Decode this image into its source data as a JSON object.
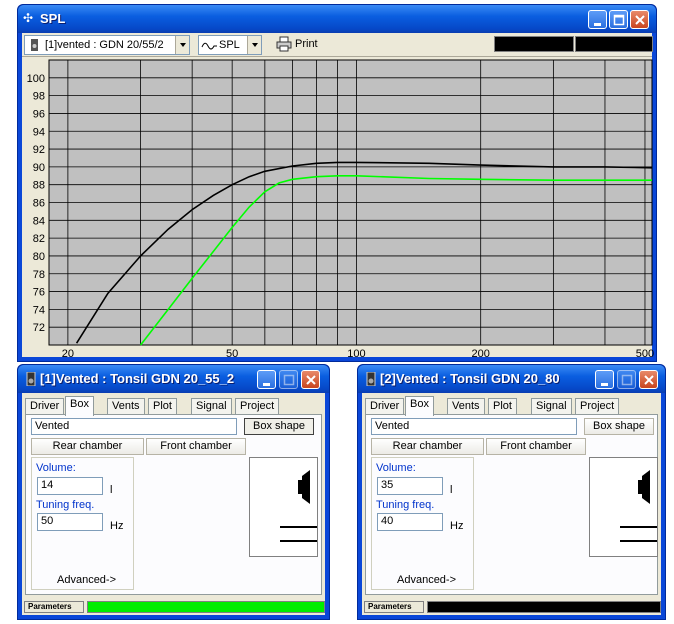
{
  "spl_window": {
    "title": "SPL",
    "toolbar": {
      "project_select": "[1]vented : GDN 20/55/2",
      "curve_select": "SPL",
      "print_label": "Print"
    }
  },
  "chart_data": {
    "type": "line",
    "xscale": "log",
    "xlim": [
      18,
      520
    ],
    "ylim": [
      70,
      102
    ],
    "x_ticks": [
      20,
      50,
      100,
      200,
      500
    ],
    "y_ticks": [
      72,
      74,
      76,
      78,
      80,
      82,
      84,
      86,
      88,
      90,
      92,
      94,
      96,
      98,
      100
    ],
    "grid": true,
    "series": [
      {
        "color": "#000000",
        "x": [
          21,
          25,
          30,
          35,
          40,
          45,
          50,
          55,
          60,
          70,
          80,
          90,
          100,
          150,
          200,
          300,
          400,
          520
        ],
        "y": [
          70.2,
          75.8,
          80.0,
          83.0,
          85.2,
          86.8,
          88.0,
          88.9,
          89.5,
          90.1,
          90.4,
          90.5,
          90.5,
          90.4,
          90.2,
          90.0,
          90.0,
          89.9
        ]
      },
      {
        "color": "#00ff00",
        "x": [
          30,
          35,
          40,
          45,
          50,
          55,
          60,
          65,
          70,
          80,
          90,
          100,
          150,
          200,
          300,
          400,
          520
        ],
        "y": [
          70.0,
          74.0,
          77.5,
          80.5,
          83.2,
          85.5,
          87.2,
          88.2,
          88.6,
          88.9,
          89.0,
          89.0,
          88.7,
          88.6,
          88.5,
          88.5,
          88.5
        ]
      }
    ]
  },
  "box_windows": [
    {
      "title": "[1]Vented : Tonsil GDN 20_55_2",
      "tabs": [
        "Driver",
        "Box",
        "Vents",
        "Plot",
        "Signal",
        "Project"
      ],
      "active_tab": 1,
      "box_type": "Vented",
      "box_shape_label": "Box shape",
      "rear_chamber_label": "Rear chamber",
      "front_chamber_label": "Front chamber",
      "volume_label": "Volume:",
      "volume_value": "14",
      "volume_unit": "l",
      "tuning_label": "Tuning freq.",
      "tuning_value": "50",
      "tuning_unit": "Hz",
      "advanced_label": "Advanced->",
      "status_label": "Parameters",
      "status_color": "#00ee00"
    },
    {
      "title": "[2]Vented : Tonsil GDN 20_80",
      "tabs": [
        "Driver",
        "Box",
        "Vents",
        "Plot",
        "Signal",
        "Project"
      ],
      "active_tab": 1,
      "box_type": "Vented",
      "box_shape_label": "Box shape",
      "rear_chamber_label": "Rear chamber",
      "front_chamber_label": "Front chamber",
      "volume_label": "Volume:",
      "volume_value": "35",
      "volume_unit": "l",
      "tuning_label": "Tuning freq.",
      "tuning_value": "40",
      "tuning_unit": "Hz",
      "advanced_label": "Advanced->",
      "status_label": "Parameters",
      "status_color": "#000000"
    }
  ]
}
